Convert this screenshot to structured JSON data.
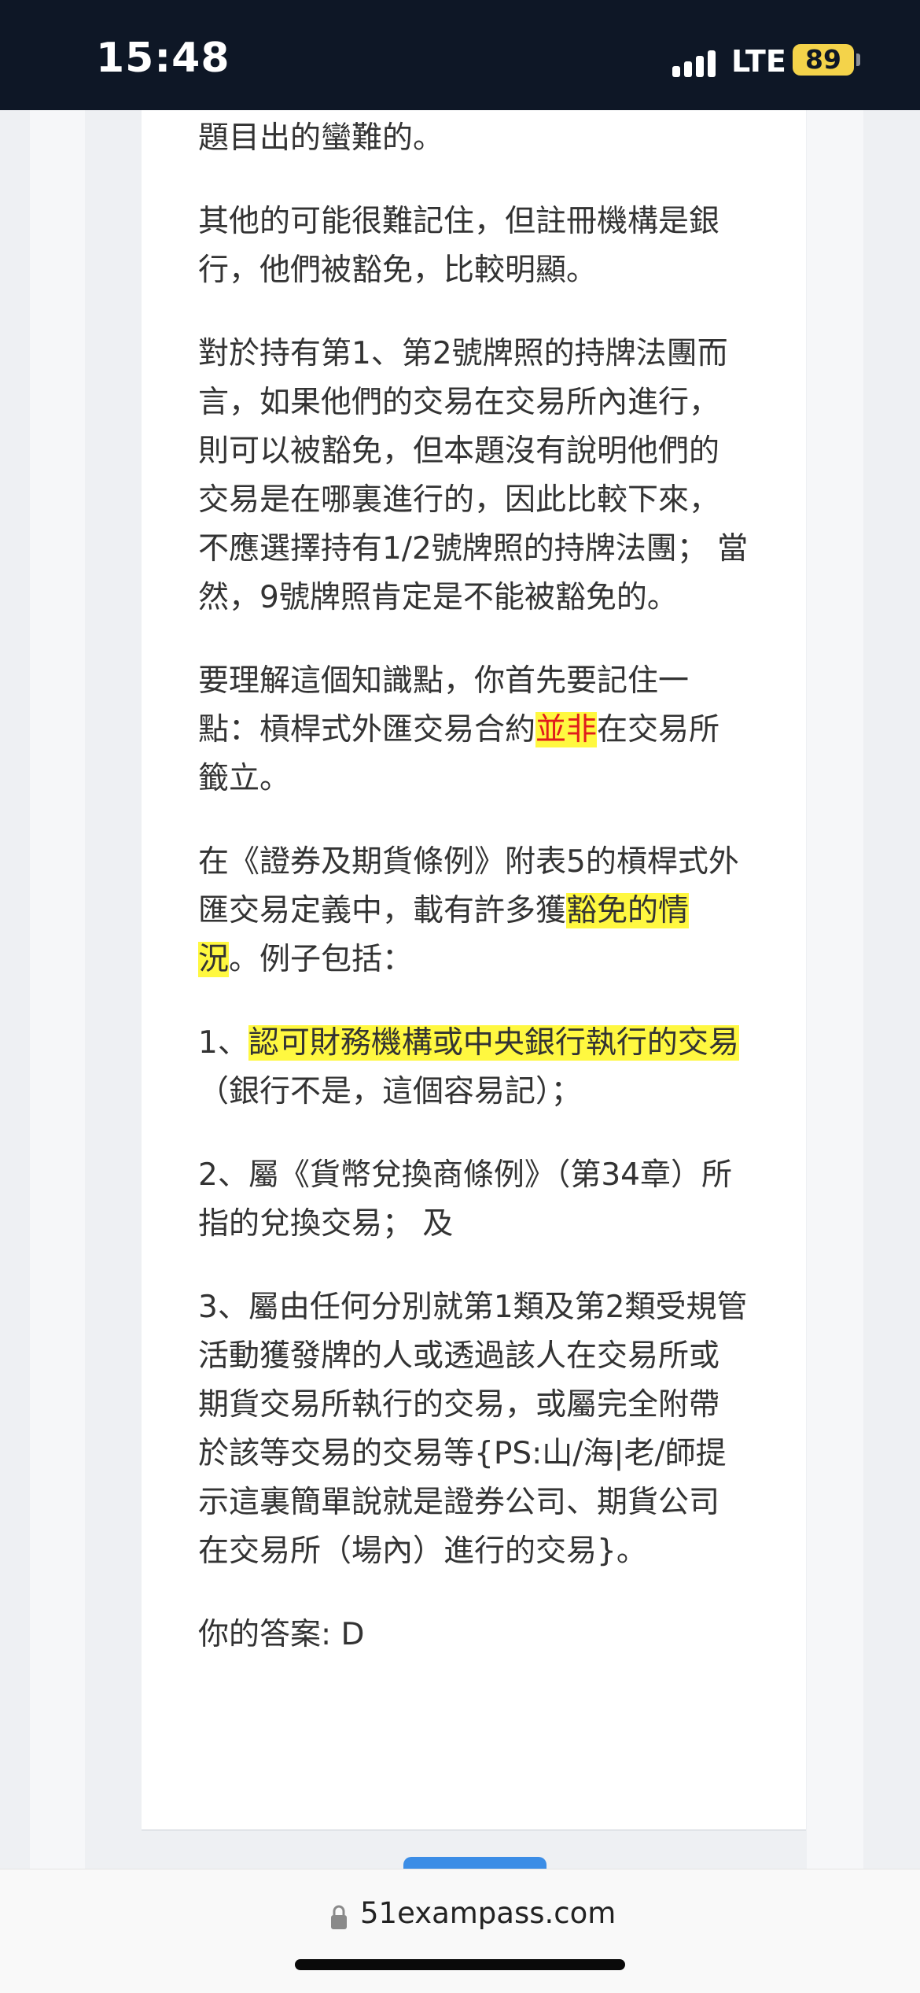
{
  "status_bar": {
    "time": "15:48",
    "network": "LTE",
    "battery": "89",
    "signal_icon": "signal-bars-icon"
  },
  "article": {
    "p1": "題目出的蠻難的。",
    "p2": "其他的可能很難記住，但註冊機構是銀行，他們被豁免，比較明顯。",
    "p3": "對於持有第1、第2號牌照的持牌法團而言，如果他們的交易在交易所內進行，則可以被豁免，但本題沒有說明他們的交易是在哪裏進行的，因此比較下來，不應選擇持有1/2號牌照的持牌法團； 當然，9號牌照肯定是不能被豁免的。",
    "p4_a": "要理解這個知識點，你首先要記住一點：槓桿式外匯交易合約",
    "p4_hl": "並非",
    "p4_b": "在交易所籤立。",
    "p5_a": "在《證券及期貨條例》附表5的槓桿式外匯交易定義中，載有許多獲",
    "p5_hl": "豁免的情況",
    "p5_b": "。例子包括：",
    "p6_a": "1、",
    "p6_hl": "認可財務機構或中央銀行執行的交易",
    "p6_b": "（銀行不是，這個容易記）；",
    "p7": "2、屬《貨幣兌換商條例》（第34章）所指的兌換交易； 及",
    "p8": "3、屬由任何分別就第1類及第2類受規管活動獲發牌的人或透過該人在交易所或期貨交易所執行的交易，或屬完全附帶於該等交易的交易等{PS:山/海|老/師提示這裏簡單說就是證券公司、期貨公司在交易所（場內）進行的交易}。",
    "answer": "你的答案: D"
  },
  "browser": {
    "url": "51exampass.com",
    "lock_icon": "lock-icon"
  },
  "colors": {
    "highlight": "#fff840",
    "red_text": "#e01c1c",
    "status_bg": "#0e1726",
    "battery": "#f4d34a"
  }
}
